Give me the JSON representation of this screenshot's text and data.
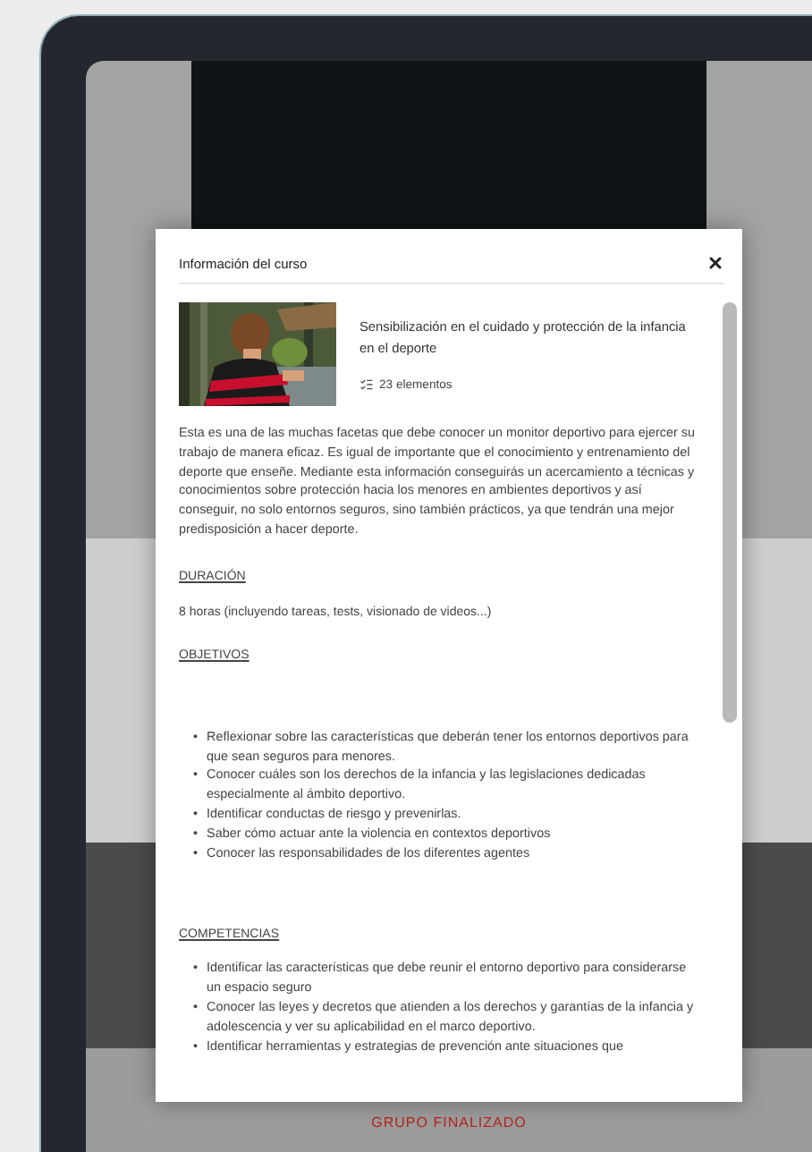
{
  "modal": {
    "title": "Información del curso",
    "course": {
      "title": "Sensibilización en el cuidado y protección de la infancia en el deporte",
      "items": "23 elementos"
    },
    "description": "Esta es una de las muchas facetas que debe conocer un monitor deportivo para ejercer su trabajo de manera eficaz. Es igual de importante que el conocimiento y entrenamiento del deporte que enseñe. Mediante esta información conseguirás un acercamiento a técnicas y conocimientos sobre protección hacia los menores en ambientes deportivos y así conseguir, no solo entornos seguros, sino también prácticos, ya que tendrán una mejor predisposición a hacer deporte.",
    "sections": [
      {
        "heading": "DURACIÓN",
        "kind": "text",
        "text": "8 horas (incluyendo tareas, tests, visionado de videos...)"
      },
      {
        "heading": "OBJETIVOS",
        "kind": "list",
        "marker": "•",
        "items": [
          "Reflexionar sobre las características que deberán tener los entornos deportivos para que sean seguros para menores.",
          "Conocer cuáles son los derechos de la infancia y las legislaciones dedicadas especialmente al ámbito deportivo.",
          "Identificar conductas de riesgo y prevenirlas.",
          "Saber cómo actuar ante la violencia en contextos deportivos",
          "Conocer las responsabilidades de los diferentes agentes"
        ]
      },
      {
        "heading": "COMPETENCIAS",
        "kind": "list",
        "marker": "•",
        "items": [
          "Identificar las características que debe reunir el entorno deportivo para considerarse un espacio seguro",
          "Conocer las leyes y decretos que atienden a los derechos y garantías de la infancia y adolescencia y ver su aplicabilidad en el marco deportivo.",
          "Identificar herramientas y estrategias de prevención ante situaciones que"
        ]
      }
    ]
  },
  "background": {
    "status": "GRUPO FINALIZADO"
  }
}
